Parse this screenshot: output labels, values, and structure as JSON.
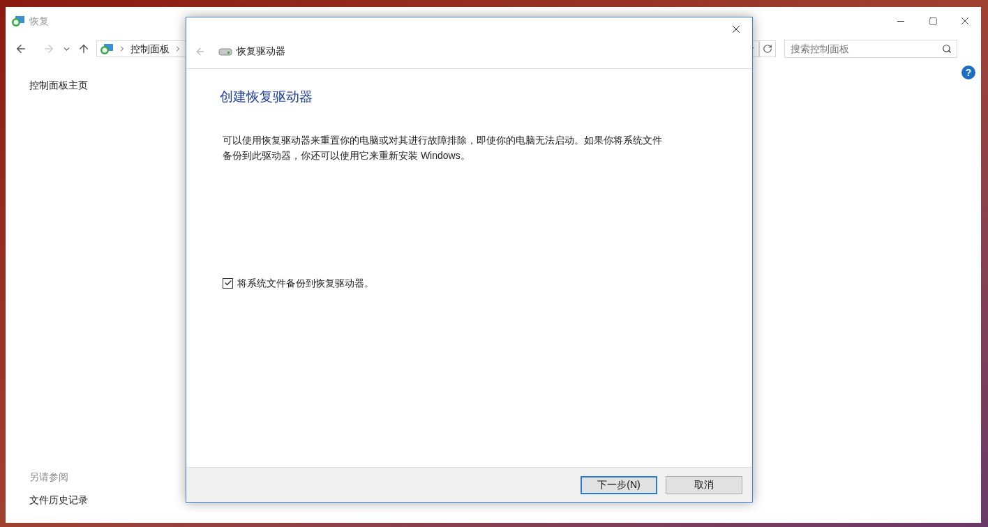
{
  "window": {
    "title": "恢复"
  },
  "navigation": {
    "breadcrumb": [
      "控制面板"
    ],
    "search": {
      "placeholder": "搜索控制面板"
    }
  },
  "help": {
    "label": "?"
  },
  "sidebar": {
    "items": [
      {
        "label": "控制面板主页"
      }
    ],
    "see_also": {
      "heading": "另请参阅",
      "items": [
        {
          "label": "文件历史记录"
        }
      ]
    }
  },
  "dialog": {
    "title": "恢复驱动器",
    "heading": "创建恢复驱动器",
    "description": "可以使用恢复驱动器来重置你的电脑或对其进行故障排除，即使你的电脑无法启动。如果你将系统文件备份到此驱动器，你还可以使用它来重新安装 Windows。",
    "checkbox": {
      "label": "将系统文件备份到恢复驱动器。",
      "checked": true
    },
    "buttons": [
      {
        "label": "下一步(N)",
        "kind": "primary"
      },
      {
        "label": "取消",
        "kind": "secondary"
      }
    ]
  }
}
